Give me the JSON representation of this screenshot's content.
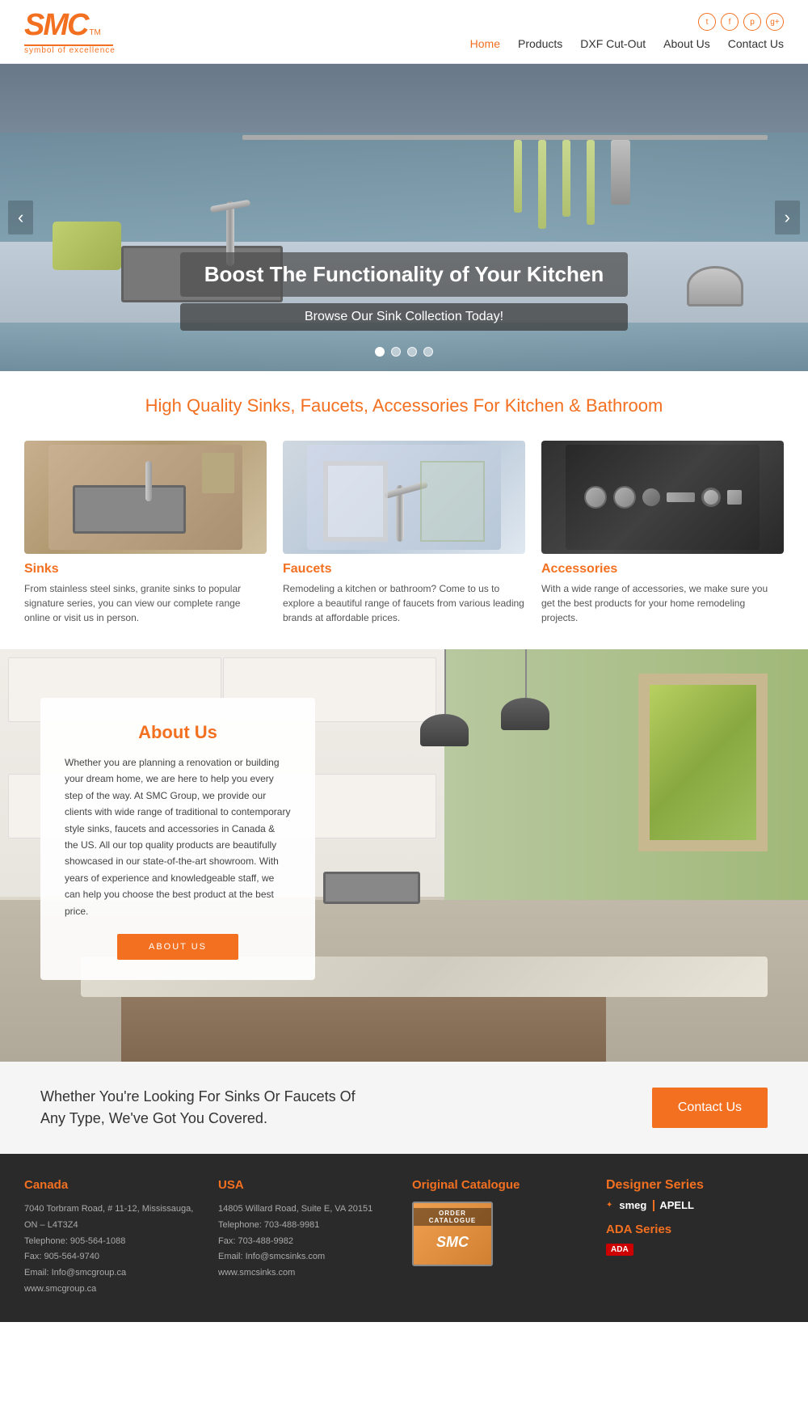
{
  "header": {
    "logo": "SMC",
    "logo_superscript": "TM",
    "tagline": "symbol of excellence",
    "nav": [
      {
        "label": "Home",
        "active": true
      },
      {
        "label": "Products",
        "active": false
      },
      {
        "label": "DXF Cut-Out",
        "active": false
      },
      {
        "label": "About Us",
        "active": false
      },
      {
        "label": "Contact Us",
        "active": false
      }
    ],
    "social": [
      {
        "icon": "twitter-icon",
        "symbol": "t"
      },
      {
        "icon": "facebook-icon",
        "symbol": "f"
      },
      {
        "icon": "pinterest-icon",
        "symbol": "p"
      },
      {
        "icon": "googleplus-icon",
        "symbol": "g+"
      }
    ]
  },
  "hero": {
    "title": "Boost The Functionality of Your Kitchen",
    "subtitle": "Browse Our Sink Collection Today!",
    "dots": [
      {
        "active": true
      },
      {
        "active": false
      },
      {
        "active": false
      },
      {
        "active": false
      }
    ],
    "arrow_left": "‹",
    "arrow_right": "›"
  },
  "products_section": {
    "heading": "High Quality Sinks, Faucets, Accessories For Kitchen & Bathroom",
    "items": [
      {
        "label": "Sinks",
        "description": "From stainless steel sinks, granite sinks to popular signature series, you can view our complete range online or visit us in person."
      },
      {
        "label": "Faucets",
        "description": "Remodeling a kitchen or bathroom? Come to us to explore a beautiful range of faucets from various leading brands at affordable prices."
      },
      {
        "label": "Accessories",
        "description": "With a wide range of accessories, we make sure you get the best products for your home remodeling projects."
      }
    ]
  },
  "about_section": {
    "title": "About Us",
    "text": "Whether you are planning a renovation or building your dream home, we are here to help you every step of the way. At SMC Group, we provide our clients with wide range of traditional to contemporary style sinks, faucets and accessories in Canada & the US. All our top quality products are beautifully showcased in our state-of-the-art showroom. With years of experience and knowledgeable staff, we can help you choose the best product at the best price.",
    "button": "ABOUT US"
  },
  "cta_section": {
    "text": "Whether You're Looking For Sinks Or Faucets Of Any Type, We've Got You Covered.",
    "button": "Contact Us"
  },
  "footer": {
    "canada": {
      "heading": "Canada",
      "address": "7040 Torbram Road, # 11-12, Mississauga, ON – L4T3Z4",
      "phone": "Telephone: 905-564-1088",
      "fax": "Fax: 905-564-9740",
      "email": "Email: Info@smcgroup.ca",
      "website": "www.smcgroup.ca"
    },
    "usa": {
      "heading": "USA",
      "address": "14805 Willard Road, Suite E, VA 20151",
      "phone": "Telephone: 703-488-9981",
      "fax": "Fax: 703-488-9982",
      "email": "Email: Info@smcsinks.com",
      "website": "www.smcsinks.com"
    },
    "catalogue": {
      "heading": "Original Catalogue",
      "label": "ORDER CATALOGUE",
      "logo": "SMC"
    },
    "brands": {
      "designer_series": "Designer Series",
      "smeg": "smeg",
      "apell": "APELL",
      "ada_series": "ADA Series"
    }
  }
}
